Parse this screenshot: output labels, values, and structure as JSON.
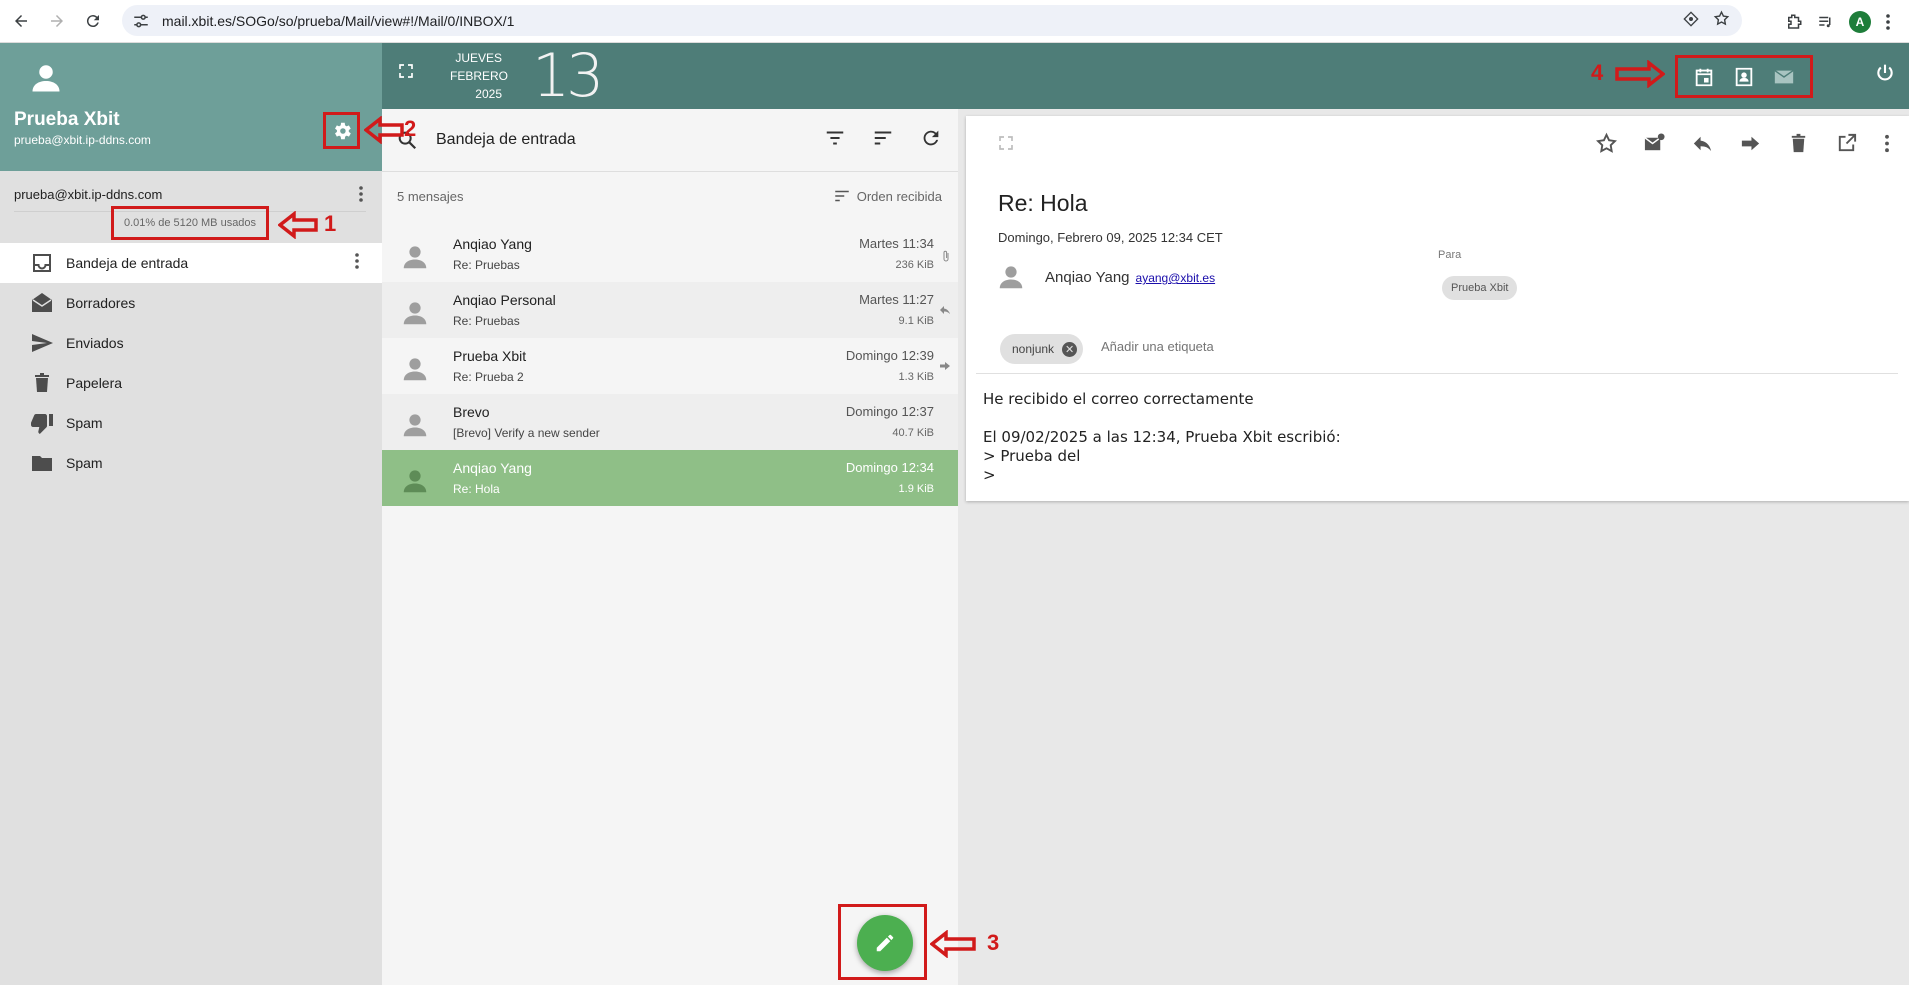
{
  "browser": {
    "url": "mail.xbit.es/SOGo/so/prueba/Mail/view#!/Mail/0/INBOX/1",
    "profile_initial": "A"
  },
  "user": {
    "name": "Prueba Xbit",
    "email": "prueba@xbit.ip-ddns.com"
  },
  "account": {
    "address": "prueba@xbit.ip-ddns.com",
    "quota": "0.01% de 5120 MB usados"
  },
  "folders": [
    {
      "label": "Bandeja de entrada",
      "icon": "inbox-icon",
      "active": true
    },
    {
      "label": "Borradores",
      "icon": "drafts-icon"
    },
    {
      "label": "Enviados",
      "icon": "send-icon"
    },
    {
      "label": "Papelera",
      "icon": "trash-icon"
    },
    {
      "label": "Spam",
      "icon": "thumb-down-icon"
    },
    {
      "label": "Spam",
      "icon": "folder-icon"
    }
  ],
  "date": {
    "weekday": "JUEVES",
    "month": "FEBRERO",
    "year": "2025",
    "day": "13"
  },
  "list": {
    "title": "Bandeja de entrada",
    "count": "5 mensajes",
    "sort": "Orden recibida",
    "messages": [
      {
        "sender": "Anqiao Yang",
        "subject": "Re: Pruebas",
        "date": "Martes 11:34",
        "size": "236 KiB",
        "flag": "attachment-icon"
      },
      {
        "sender": "Anqiao Personal",
        "subject": "Re: Pruebas",
        "date": "Martes 11:27",
        "size": "9.1 KiB",
        "flag": "replied-icon"
      },
      {
        "sender": "Prueba Xbit",
        "subject": "Re: Prueba 2",
        "date": "Domingo 12:39",
        "size": "1.3 KiB",
        "flag": "forwarded-icon"
      },
      {
        "sender": "Brevo",
        "subject": "[Brevo] Verify a new sender",
        "date": "Domingo 12:37",
        "size": "40.7 KiB"
      },
      {
        "sender": "Anqiao Yang",
        "subject": "Re: Hola",
        "date": "Domingo 12:34",
        "size": "1.9 KiB",
        "selected": true
      }
    ]
  },
  "reading": {
    "subject": "Re: Hola",
    "date": "Domingo, Febrero 09, 2025 12:34 CET",
    "from_name": "Anqiao Yang",
    "from_email": "ayang@xbit.es",
    "to_label": "Para",
    "to_chip": "Prueba Xbit",
    "tag": "nonjunk",
    "tag_placeholder": "Añadir una etiqueta",
    "body": "He recibido el correo correctamente\n\nEl 09/02/2025 a las 12:34, Prueba Xbit escribió:\n> Prueba del\n>"
  },
  "annotations": {
    "one": "1",
    "two": "2",
    "three": "3",
    "four": "4"
  },
  "colors": {
    "sidebar_header": "#6e9f99",
    "appbar": "#4e7d78",
    "selected_row": "#8fbf87",
    "fab": "#4caf50",
    "annotation_red": "#d11a1a"
  }
}
